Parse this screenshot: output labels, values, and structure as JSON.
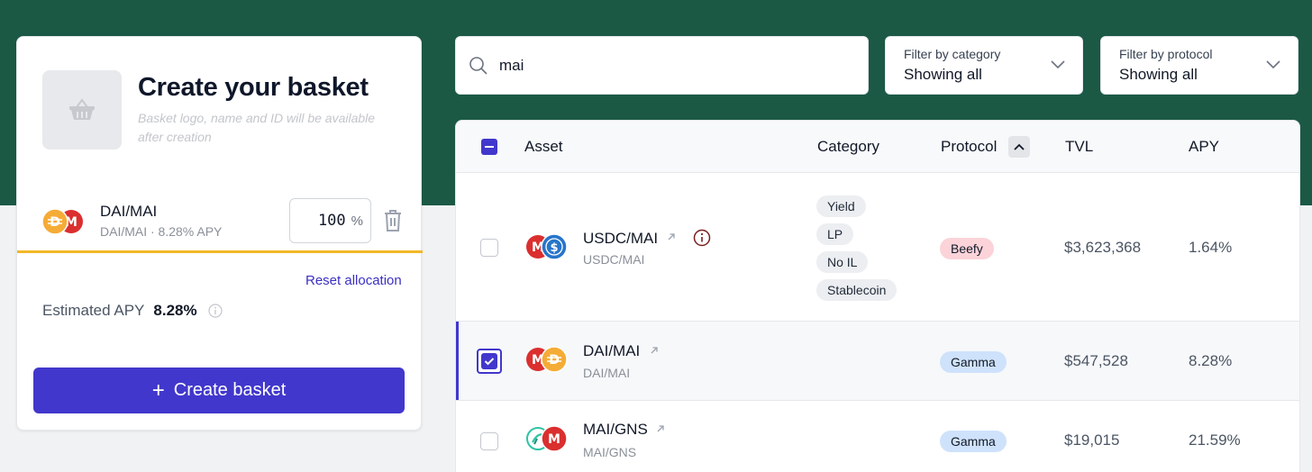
{
  "builder": {
    "title": "Create your basket",
    "hint": "Basket logo, name and ID will be available after creation",
    "allocation": {
      "name": "DAI/MAI",
      "sub": "DAI/MAI · 8.28% APY",
      "value": "100",
      "unit": "%"
    },
    "reset_label": "Reset allocation",
    "estimated_label": "Estimated APY",
    "estimated_value": "8.28%",
    "create_label": "Create basket"
  },
  "search": {
    "value": "mai"
  },
  "filters": [
    {
      "label": "Filter by category",
      "value": "Showing all"
    },
    {
      "label": "Filter by protocol",
      "value": "Showing all"
    }
  ],
  "table": {
    "headers": {
      "asset": "Asset",
      "category": "Category",
      "protocol": "Protocol",
      "tvl": "TVL",
      "apy": "APY"
    },
    "rows": [
      {
        "name": "USDC/MAI",
        "sub": "USDC/MAI",
        "categories": [
          "Yield",
          "LP",
          "No IL",
          "Stablecoin"
        ],
        "protocol": "Beefy",
        "tvl": "$3,623,368",
        "apy": "1.64%",
        "selected": false
      },
      {
        "name": "DAI/MAI",
        "sub": "DAI/MAI",
        "categories": [],
        "protocol": "Gamma",
        "tvl": "$547,528",
        "apy": "8.28%",
        "selected": true
      },
      {
        "name": "MAI/GNS",
        "sub": "MAI/GNS",
        "categories": [],
        "protocol": "Gamma",
        "tvl": "$19,015",
        "apy": "21.59%",
        "selected": false
      }
    ]
  },
  "colors": {
    "header_bg": "#1b5945",
    "accent": "#4137cc",
    "allocation_bar": "#f2b827",
    "dai": "#f5ac37",
    "mai": "#db2f2f",
    "usdc": "#2775ca",
    "beefy_badge": "#fbd3d9",
    "gamma_badge": "#cfe2fb"
  },
  "icons": [
    "basket-icon",
    "dai-token-icon",
    "mai-token-icon",
    "usdc-token-icon",
    "gns-token-icon",
    "trash-icon",
    "info-icon",
    "search-icon",
    "chevron-down-icon",
    "chevron-up-icon",
    "external-link-icon",
    "plus-icon",
    "check-icon"
  ]
}
